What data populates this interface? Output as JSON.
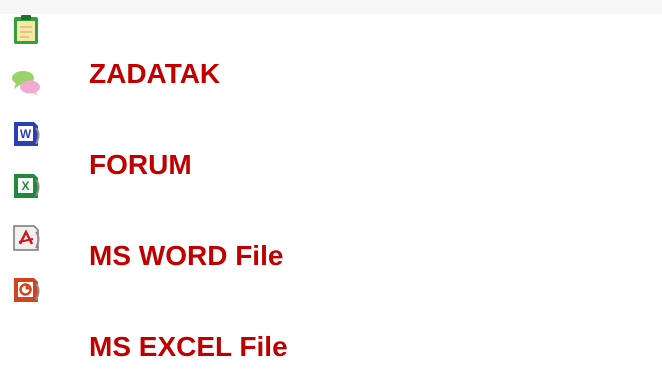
{
  "colors": {
    "link": "#c00000"
  },
  "items": [
    {
      "label": "ZADATAK"
    },
    {
      "label": "FORUM"
    },
    {
      "label": "MS WORD File"
    },
    {
      "label": "MS EXCEL File"
    }
  ],
  "icons": [
    "assignment-icon",
    "forum-icon",
    "word-file-icon",
    "excel-file-icon",
    "pdf-file-icon",
    "powerpoint-file-icon"
  ]
}
